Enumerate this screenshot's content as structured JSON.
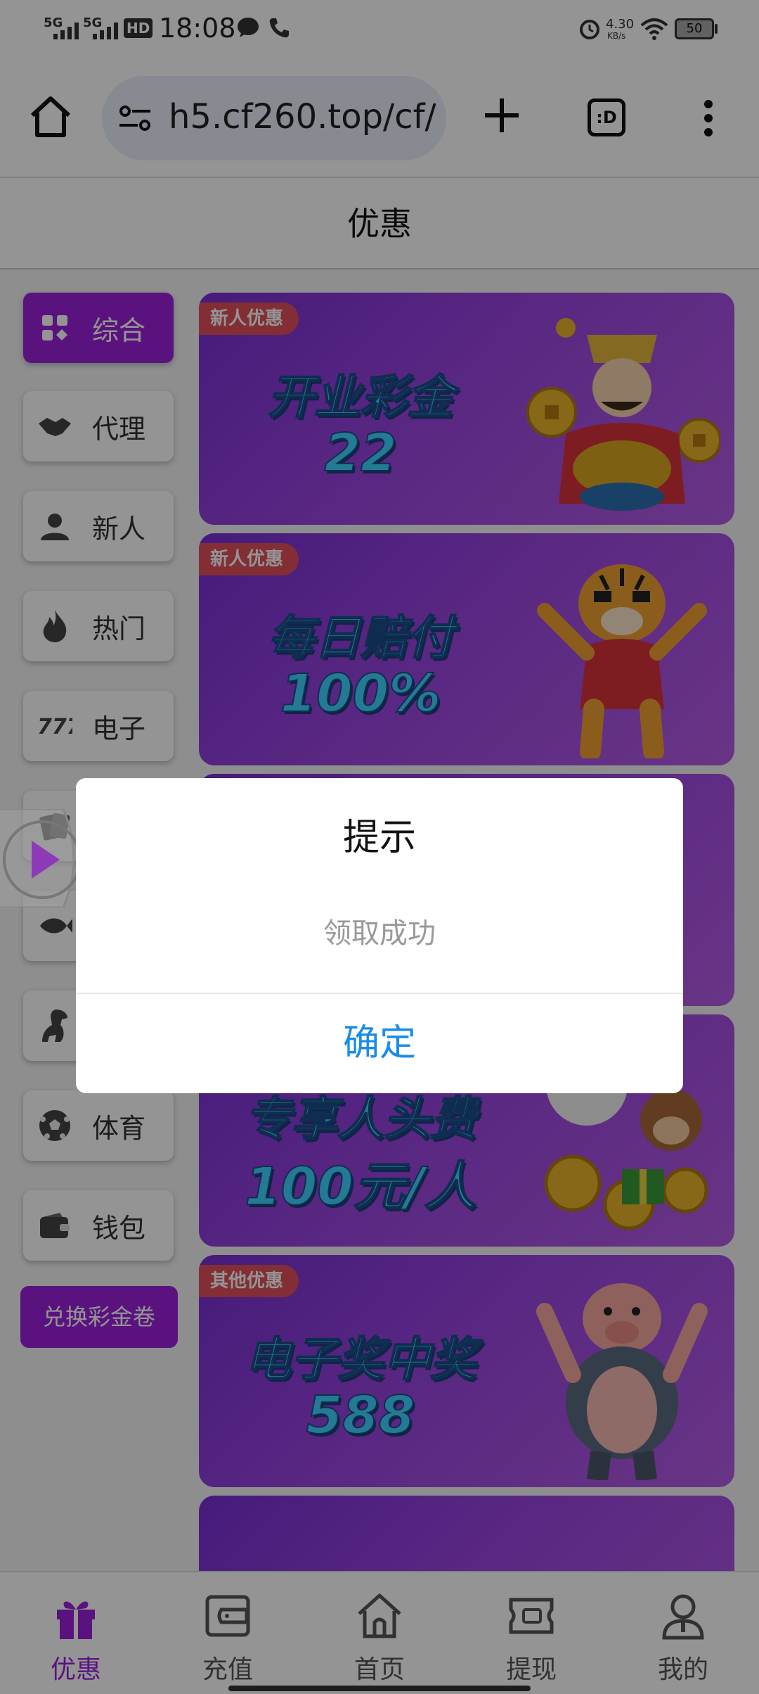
{
  "status": {
    "time": "18:08",
    "net1": "5G",
    "net2": "5G",
    "hd": "HD",
    "speed": "4.30",
    "speed_unit": "KB/s",
    "battery": "50"
  },
  "browser": {
    "url": "h5.cf260.top/cf/",
    "tab_label": ":D"
  },
  "page": {
    "title": "优惠",
    "categories": [
      {
        "label": "综合",
        "icon": "grid-icon"
      },
      {
        "label": "代理",
        "icon": "handshake-icon"
      },
      {
        "label": "新人",
        "icon": "person-icon"
      },
      {
        "label": "热门",
        "icon": "flame-icon"
      },
      {
        "label": "电子",
        "icon": "slot-777-icon"
      },
      {
        "label": "",
        "icon": "cards-icon"
      },
      {
        "label": "",
        "icon": "fish-icon"
      },
      {
        "label": "",
        "icon": "dinosaur-icon"
      },
      {
        "label": "体育",
        "icon": "soccer-ball-icon"
      },
      {
        "label": "钱包",
        "icon": "wallet-icon"
      }
    ],
    "redeem_label": "兑换彩金卷",
    "banners": [
      {
        "tag": "新人优惠",
        "line1": "开业彩金",
        "line2": "22"
      },
      {
        "tag": "新人优惠",
        "line1": "每日赔付",
        "line2": "100%"
      },
      {
        "tag": "",
        "line1": "",
        "line2": ""
      },
      {
        "tag": "",
        "line1": "专享人头费",
        "line2": "100元/人"
      },
      {
        "tag": "其他优惠",
        "line1": "电子奖中奖",
        "line2": "588"
      }
    ]
  },
  "nav": [
    {
      "label": "优惠",
      "icon": "gift-icon"
    },
    {
      "label": "充值",
      "icon": "wallet-card-icon"
    },
    {
      "label": "首页",
      "icon": "home-icon"
    },
    {
      "label": "提现",
      "icon": "ticket-icon"
    },
    {
      "label": "我的",
      "icon": "user-icon"
    }
  ],
  "modal": {
    "title": "提示",
    "message": "领取成功",
    "confirm": "确定"
  },
  "colors": {
    "accent": "#9b22d9",
    "link_blue": "#1a8ce8",
    "tag_red": "#e0505a"
  }
}
